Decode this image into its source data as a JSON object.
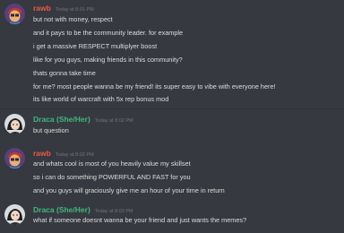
{
  "colors": {
    "background": "#36393f",
    "rawb_name": "#e95a46",
    "draca_name": "#43b581",
    "text": "#dcddde",
    "timestamp": "#72767d"
  },
  "groups": [
    {
      "username": "rawb",
      "timestamp": "Today at 8:01 PM",
      "avatar_icon": "rawb-avatar-icon",
      "lines": [
        "but not with money, respect",
        "and it pays to be the community leader. for example",
        "i get a massive RESPECT multiplyer boost",
        "like for you guys, making friends in this community?",
        "thats gonna take time",
        "for me? most people wanna be my friend! its super easy to vibe with everyone here!",
        "its like world of warcraft with 5x rep bonus mod"
      ]
    },
    {
      "username": "Draca (She/Her)",
      "timestamp": "Today at 8:02 PM",
      "avatar_icon": "draca-avatar-icon",
      "lines": [
        "but question"
      ]
    },
    {
      "username": "rawb",
      "timestamp": "Today at 8:02 PM",
      "avatar_icon": "rawb-avatar-icon",
      "lines": [
        "and whats cool is most of you heavily value my skillset",
        "so i can do something POWERFUL AND FAST for you",
        "and you guys will graciously give me an hour of your time in return"
      ]
    },
    {
      "username": "Draca (She/Her)",
      "timestamp": "Today at 8:03 PM",
      "avatar_icon": "draca-avatar-icon",
      "lines": [
        "what if someone doesnt wanna be your friend and just wants the memes?"
      ]
    }
  ]
}
